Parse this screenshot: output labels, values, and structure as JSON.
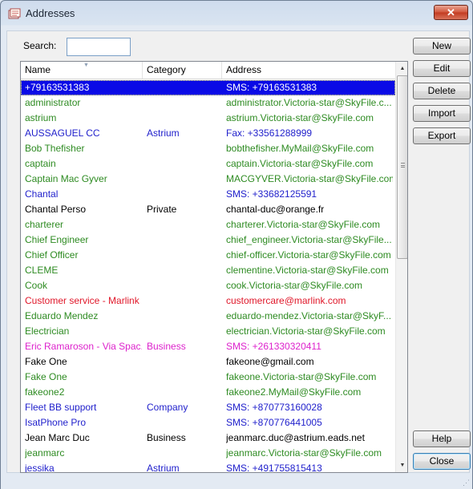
{
  "window": {
    "title": "Addresses",
    "close_glyph": "✕"
  },
  "search": {
    "label": "Search:",
    "value": "",
    "placeholder": ""
  },
  "columns": {
    "name": "Name",
    "category": "Category",
    "address": "Address"
  },
  "colors": {
    "blue": "#2222cc",
    "green": "#2e8b22",
    "black": "#000000",
    "red": "#e0182a",
    "magenta": "#dd22cc",
    "selection": "#0a0ae6"
  },
  "rows": [
    {
      "name": "+79163531383",
      "category": "",
      "address": "SMS: +79163531383",
      "color": "#000000",
      "selected": true
    },
    {
      "name": "administrator",
      "category": "",
      "address": "administrator.Victoria-star@SkyFile.c...",
      "color": "#2e8b22"
    },
    {
      "name": "astrium",
      "category": "",
      "address": "astrium.Victoria-star@SkyFile.com",
      "color": "#2e8b22"
    },
    {
      "name": "AUSSAGUEL CC",
      "category": "Astrium",
      "address": "Fax: +33561288999",
      "color": "#2222cc"
    },
    {
      "name": "Bob Thefisher",
      "category": "",
      "address": "bobthefisher.MyMail@SkyFile.com",
      "color": "#2e8b22"
    },
    {
      "name": "captain",
      "category": "",
      "address": "captain.Victoria-star@SkyFile.com",
      "color": "#2e8b22"
    },
    {
      "name": "Captain Mac Gyver",
      "category": "",
      "address": "MACGYVER.Victoria-star@SkyFile.com",
      "color": "#2e8b22"
    },
    {
      "name": "Chantal",
      "category": "",
      "address": "SMS: +33682125591",
      "color": "#2222cc"
    },
    {
      "name": "Chantal Perso",
      "category": "Private",
      "address": "chantal-duc@orange.fr",
      "color": "#000000"
    },
    {
      "name": "charterer",
      "category": "",
      "address": "charterer.Victoria-star@SkyFile.com",
      "color": "#2e8b22"
    },
    {
      "name": "Chief Engineer",
      "category": "",
      "address": "chief_engineer.Victoria-star@SkyFile...",
      "color": "#2e8b22"
    },
    {
      "name": "Chief Officer",
      "category": "",
      "address": "chief-officer.Victoria-star@SkyFile.com",
      "color": "#2e8b22"
    },
    {
      "name": "CLEME",
      "category": "",
      "address": "clementine.Victoria-star@SkyFile.com",
      "color": "#2e8b22"
    },
    {
      "name": "Cook",
      "category": "",
      "address": "cook.Victoria-star@SkyFile.com",
      "color": "#2e8b22"
    },
    {
      "name": "Customer service - Marlink",
      "category": "",
      "address": "customercare@marlink.com",
      "color": "#e0182a"
    },
    {
      "name": "Eduardo Mendez",
      "category": "",
      "address": "eduardo-mendez.Victoria-star@SkyF...",
      "color": "#2e8b22"
    },
    {
      "name": "Electrician",
      "category": "",
      "address": "electrician.Victoria-star@SkyFile.com",
      "color": "#2e8b22"
    },
    {
      "name": "Eric Ramaroson - Via Spac...",
      "category": "Business",
      "address": "SMS: +261330320411",
      "color": "#dd22cc"
    },
    {
      "name": "Fake One",
      "category": "",
      "address": "fakeone@gmail.com",
      "color": "#000000"
    },
    {
      "name": "Fake One",
      "category": "",
      "address": "fakeone.Victoria-star@SkyFile.com",
      "color": "#2e8b22"
    },
    {
      "name": "fakeone2",
      "category": "",
      "address": "fakeone2.MyMail@SkyFile.com",
      "color": "#2e8b22"
    },
    {
      "name": "Fleet BB support",
      "category": "Company",
      "address": "SMS: +870773160028",
      "color": "#2222cc"
    },
    {
      "name": "IsatPhone Pro",
      "category": "",
      "address": "SMS: +870776441005",
      "color": "#2222cc"
    },
    {
      "name": "Jean Marc Duc",
      "category": "Business",
      "address": "jeanmarc.duc@astrium.eads.net",
      "color": "#000000"
    },
    {
      "name": "jeanmarc",
      "category": "",
      "address": "jeanmarc.Victoria-star@SkyFile.com",
      "color": "#2e8b22"
    },
    {
      "name": "jessika",
      "category": "Astrium",
      "address": "SMS: +491755815413",
      "color": "#2222cc"
    }
  ],
  "buttons": {
    "new": "New",
    "edit": "Edit",
    "delete": "Delete",
    "import": "Import",
    "export": "Export",
    "help": "Help",
    "close": "Close"
  },
  "icons": {
    "app": "addresses-icon",
    "close": "close-icon",
    "sort": "sort-arrow-icon",
    "scroll_up": "scroll-up-icon",
    "scroll_down": "scroll-down-icon",
    "resize": "resize-grip-icon"
  }
}
